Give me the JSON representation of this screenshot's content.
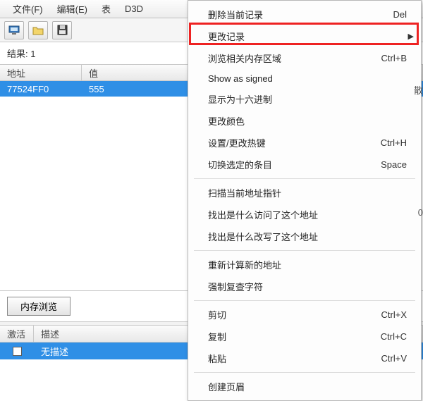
{
  "menubar": {
    "file": "文件(F)",
    "edit": "编辑(E)",
    "table": "表",
    "d3d": "D3D"
  },
  "results": {
    "label": "结果:",
    "count": "1"
  },
  "columns": {
    "address": "地址",
    "value": "值"
  },
  "rows": [
    {
      "address": "77524FF0",
      "value": "555"
    }
  ],
  "memory_browse": "内存浏览",
  "lower": {
    "activate": "激活",
    "description": "描述",
    "rows": [
      {
        "description": "无描述"
      }
    ]
  },
  "context_menu": {
    "items": [
      {
        "label": "删除当前记录",
        "shortcut": "Del"
      },
      {
        "label": "更改记录",
        "submenu": true
      },
      {
        "label": "浏览相关内存区域",
        "shortcut": "Ctrl+B"
      },
      {
        "label": "Show as signed"
      },
      {
        "label": "显示为十六进制"
      },
      {
        "label": "更改颜色"
      },
      {
        "label": "设置/更改热键",
        "shortcut": "Ctrl+H"
      },
      {
        "label": "切换选定的条目",
        "shortcut": "Space"
      },
      {
        "sep": true
      },
      {
        "label": "扫描当前地址指针"
      },
      {
        "label": "找出是什么访问了这个地址"
      },
      {
        "label": "找出是什么改写了这个地址"
      },
      {
        "sep": true
      },
      {
        "label": "重新计算新的地址"
      },
      {
        "label": "强制复查字符"
      },
      {
        "sep": true
      },
      {
        "label": "剪切",
        "shortcut": "Ctrl+X"
      },
      {
        "label": "复制",
        "shortcut": "Ctrl+C"
      },
      {
        "label": "粘贴",
        "shortcut": "Ctrl+V"
      },
      {
        "sep": true
      },
      {
        "label": "创建页眉"
      }
    ]
  },
  "edge_hints": {
    "a": "散",
    "b": "0"
  }
}
